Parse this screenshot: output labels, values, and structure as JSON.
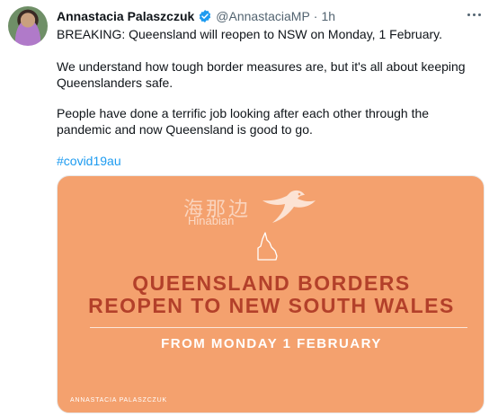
{
  "author": {
    "name": "Annastacia Palaszczuk",
    "handle": "@AnnastaciaMP",
    "separator": "·",
    "time": "1h"
  },
  "tweet": {
    "line1": "BREAKING: Queensland will reopen to NSW on Monday, 1 February.",
    "para2": "We understand how tough border measures are, but it's all about keeping Queenslanders safe.",
    "para3": "People have done a terrific job looking after each other through the pandemic and now Queensland is good to go.",
    "hashtag": "#covid19au"
  },
  "image": {
    "watermark_cn": "海那边",
    "watermark_en": "Hinabian",
    "headline_line1": "QUEENSLAND BORDERS",
    "headline_line2": "REOPEN TO NEW SOUTH WALES",
    "subheadline": "FROM MONDAY 1 FEBRUARY",
    "credit": "ANNASTACIA PALASZCZUK"
  },
  "colors": {
    "card_bg": "#f4a16e",
    "headline": "#b3402a",
    "link": "#1d9bf0",
    "verified": "#1d9bf0"
  }
}
